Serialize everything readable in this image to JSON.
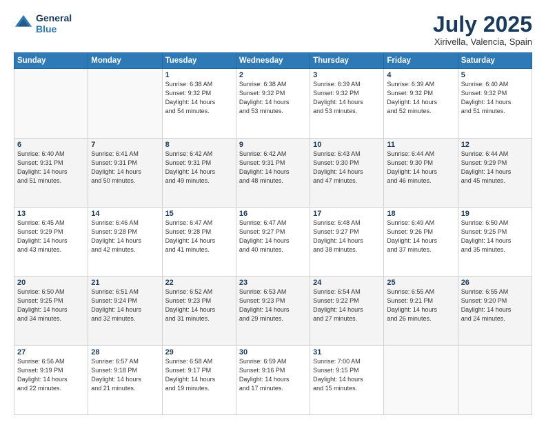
{
  "header": {
    "logo_line1": "General",
    "logo_line2": "Blue",
    "title": "July 2025",
    "subtitle": "Xirivella, Valencia, Spain"
  },
  "days_of_week": [
    "Sunday",
    "Monday",
    "Tuesday",
    "Wednesday",
    "Thursday",
    "Friday",
    "Saturday"
  ],
  "weeks": [
    [
      {
        "num": "",
        "info": ""
      },
      {
        "num": "",
        "info": ""
      },
      {
        "num": "1",
        "info": "Sunrise: 6:38 AM\nSunset: 9:32 PM\nDaylight: 14 hours\nand 54 minutes."
      },
      {
        "num": "2",
        "info": "Sunrise: 6:38 AM\nSunset: 9:32 PM\nDaylight: 14 hours\nand 53 minutes."
      },
      {
        "num": "3",
        "info": "Sunrise: 6:39 AM\nSunset: 9:32 PM\nDaylight: 14 hours\nand 53 minutes."
      },
      {
        "num": "4",
        "info": "Sunrise: 6:39 AM\nSunset: 9:32 PM\nDaylight: 14 hours\nand 52 minutes."
      },
      {
        "num": "5",
        "info": "Sunrise: 6:40 AM\nSunset: 9:32 PM\nDaylight: 14 hours\nand 51 minutes."
      }
    ],
    [
      {
        "num": "6",
        "info": "Sunrise: 6:40 AM\nSunset: 9:31 PM\nDaylight: 14 hours\nand 51 minutes."
      },
      {
        "num": "7",
        "info": "Sunrise: 6:41 AM\nSunset: 9:31 PM\nDaylight: 14 hours\nand 50 minutes."
      },
      {
        "num": "8",
        "info": "Sunrise: 6:42 AM\nSunset: 9:31 PM\nDaylight: 14 hours\nand 49 minutes."
      },
      {
        "num": "9",
        "info": "Sunrise: 6:42 AM\nSunset: 9:31 PM\nDaylight: 14 hours\nand 48 minutes."
      },
      {
        "num": "10",
        "info": "Sunrise: 6:43 AM\nSunset: 9:30 PM\nDaylight: 14 hours\nand 47 minutes."
      },
      {
        "num": "11",
        "info": "Sunrise: 6:44 AM\nSunset: 9:30 PM\nDaylight: 14 hours\nand 46 minutes."
      },
      {
        "num": "12",
        "info": "Sunrise: 6:44 AM\nSunset: 9:29 PM\nDaylight: 14 hours\nand 45 minutes."
      }
    ],
    [
      {
        "num": "13",
        "info": "Sunrise: 6:45 AM\nSunset: 9:29 PM\nDaylight: 14 hours\nand 43 minutes."
      },
      {
        "num": "14",
        "info": "Sunrise: 6:46 AM\nSunset: 9:28 PM\nDaylight: 14 hours\nand 42 minutes."
      },
      {
        "num": "15",
        "info": "Sunrise: 6:47 AM\nSunset: 9:28 PM\nDaylight: 14 hours\nand 41 minutes."
      },
      {
        "num": "16",
        "info": "Sunrise: 6:47 AM\nSunset: 9:27 PM\nDaylight: 14 hours\nand 40 minutes."
      },
      {
        "num": "17",
        "info": "Sunrise: 6:48 AM\nSunset: 9:27 PM\nDaylight: 14 hours\nand 38 minutes."
      },
      {
        "num": "18",
        "info": "Sunrise: 6:49 AM\nSunset: 9:26 PM\nDaylight: 14 hours\nand 37 minutes."
      },
      {
        "num": "19",
        "info": "Sunrise: 6:50 AM\nSunset: 9:25 PM\nDaylight: 14 hours\nand 35 minutes."
      }
    ],
    [
      {
        "num": "20",
        "info": "Sunrise: 6:50 AM\nSunset: 9:25 PM\nDaylight: 14 hours\nand 34 minutes."
      },
      {
        "num": "21",
        "info": "Sunrise: 6:51 AM\nSunset: 9:24 PM\nDaylight: 14 hours\nand 32 minutes."
      },
      {
        "num": "22",
        "info": "Sunrise: 6:52 AM\nSunset: 9:23 PM\nDaylight: 14 hours\nand 31 minutes."
      },
      {
        "num": "23",
        "info": "Sunrise: 6:53 AM\nSunset: 9:23 PM\nDaylight: 14 hours\nand 29 minutes."
      },
      {
        "num": "24",
        "info": "Sunrise: 6:54 AM\nSunset: 9:22 PM\nDaylight: 14 hours\nand 27 minutes."
      },
      {
        "num": "25",
        "info": "Sunrise: 6:55 AM\nSunset: 9:21 PM\nDaylight: 14 hours\nand 26 minutes."
      },
      {
        "num": "26",
        "info": "Sunrise: 6:55 AM\nSunset: 9:20 PM\nDaylight: 14 hours\nand 24 minutes."
      }
    ],
    [
      {
        "num": "27",
        "info": "Sunrise: 6:56 AM\nSunset: 9:19 PM\nDaylight: 14 hours\nand 22 minutes."
      },
      {
        "num": "28",
        "info": "Sunrise: 6:57 AM\nSunset: 9:18 PM\nDaylight: 14 hours\nand 21 minutes."
      },
      {
        "num": "29",
        "info": "Sunrise: 6:58 AM\nSunset: 9:17 PM\nDaylight: 14 hours\nand 19 minutes."
      },
      {
        "num": "30",
        "info": "Sunrise: 6:59 AM\nSunset: 9:16 PM\nDaylight: 14 hours\nand 17 minutes."
      },
      {
        "num": "31",
        "info": "Sunrise: 7:00 AM\nSunset: 9:15 PM\nDaylight: 14 hours\nand 15 minutes."
      },
      {
        "num": "",
        "info": ""
      },
      {
        "num": "",
        "info": ""
      }
    ]
  ]
}
